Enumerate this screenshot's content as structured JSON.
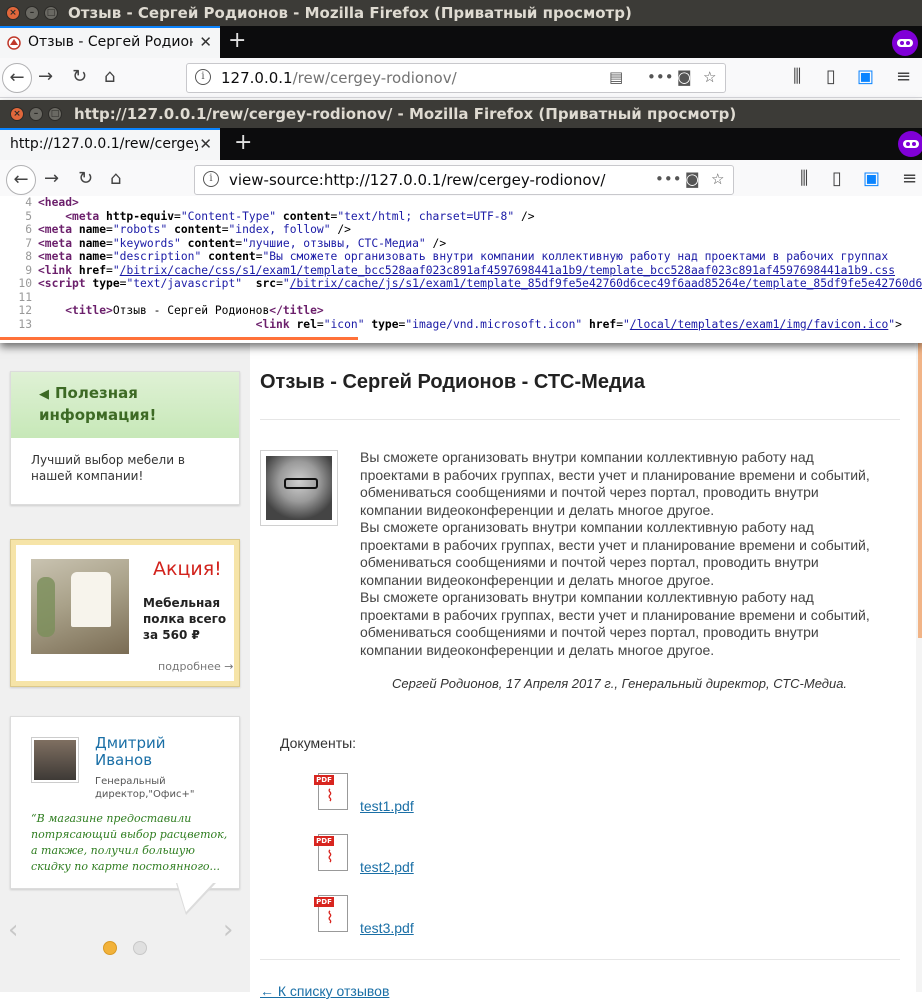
{
  "window": {
    "title": "Отзыв - Сергей Родионов - Mozilla Firefox (Приватный просмотр)",
    "tab_label": "Отзыв - Сергей Родионов",
    "url_host": "127.0.0.1",
    "url_path": "/rew/cergey-rodionov/"
  },
  "popup": {
    "title": "http://127.0.0.1/rew/cergey-rodionov/ - Mozilla Firefox (Приватный просмотр)",
    "tab_label": "http://127.0.0.1/rew/cergey",
    "url": "view-source:http://127.0.0.1/rew/cergey-rodionov/"
  },
  "source_lines": [
    {
      "n": "4",
      "parts": [
        [
          "tag",
          "<head>"
        ]
      ]
    },
    {
      "n": "5",
      "parts": [
        [
          "",
          "    "
        ],
        [
          "tag",
          "<meta "
        ],
        [
          "an",
          "http-equiv"
        ],
        [
          "",
          "="
        ],
        [
          "av",
          "\"Content-Type\""
        ],
        [
          "",
          " "
        ],
        [
          "an",
          "content"
        ],
        [
          "",
          "="
        ],
        [
          "av",
          "\"text/html; charset=UTF-8\""
        ],
        [
          "",
          " />"
        ]
      ]
    },
    {
      "n": "6",
      "parts": [
        [
          "tag",
          "<meta "
        ],
        [
          "an",
          "name"
        ],
        [
          "",
          "="
        ],
        [
          "av",
          "\"robots\""
        ],
        [
          "",
          " "
        ],
        [
          "an",
          "content"
        ],
        [
          "",
          "="
        ],
        [
          "av",
          "\"index, follow\""
        ],
        [
          "",
          " />"
        ]
      ]
    },
    {
      "n": "7",
      "parts": [
        [
          "tag",
          "<meta "
        ],
        [
          "an",
          "name"
        ],
        [
          "",
          "="
        ],
        [
          "av",
          "\"keywords\""
        ],
        [
          "",
          " "
        ],
        [
          "an",
          "content"
        ],
        [
          "",
          "="
        ],
        [
          "av",
          "\"лучшие, отзывы, СТС-Медиа\""
        ],
        [
          "",
          " />"
        ]
      ]
    },
    {
      "n": "8",
      "parts": [
        [
          "tag",
          "<meta "
        ],
        [
          "an",
          "name"
        ],
        [
          "",
          "="
        ],
        [
          "av",
          "\"description\""
        ],
        [
          "",
          " "
        ],
        [
          "an",
          "content"
        ],
        [
          "",
          "="
        ],
        [
          "av",
          "\"Вы сможете организовать внутри компании коллективную работу над проектами в рабочих группах"
        ]
      ]
    },
    {
      "n": "9",
      "parts": [
        [
          "tag",
          "<link "
        ],
        [
          "an",
          "href"
        ],
        [
          "",
          "="
        ],
        [
          "av",
          "\""
        ],
        [
          "lk",
          "/bitrix/cache/css/s1/exam1/template_bcc528aaf023c891af4597698441a1b9/template_bcc528aaf023c891af4597698441a1b9.css"
        ]
      ]
    },
    {
      "n": "10",
      "parts": [
        [
          "tag",
          "<script "
        ],
        [
          "an",
          "type"
        ],
        [
          "",
          "="
        ],
        [
          "av",
          "\"text/javascript\""
        ],
        [
          "",
          "  "
        ],
        [
          "an",
          "src"
        ],
        [
          "",
          "="
        ],
        [
          "av",
          "\""
        ],
        [
          "lk",
          "/bitrix/cache/js/s1/exam1/template_85df9fe5e42760d6cec49f6aad85264e/template_85df9fe5e42760d6cec49f6aad85264e.js"
        ]
      ]
    },
    {
      "n": "11",
      "parts": [
        [
          "",
          ""
        ]
      ]
    },
    {
      "n": "12",
      "parts": [
        [
          "",
          "    "
        ],
        [
          "tag",
          "<title>"
        ],
        [
          "",
          "Отзыв - Сергей Родионов"
        ],
        [
          "tag",
          "</title>"
        ]
      ]
    },
    {
      "n": "13",
      "parts": [
        [
          "",
          "                                "
        ],
        [
          "tag",
          "<link "
        ],
        [
          "an",
          "rel"
        ],
        [
          "",
          "="
        ],
        [
          "av",
          "\"icon\""
        ],
        [
          "",
          " "
        ],
        [
          "an",
          "type"
        ],
        [
          "",
          "="
        ],
        [
          "av",
          "\"image/vnd.microsoft.icon\""
        ],
        [
          "",
          " "
        ],
        [
          "an",
          "href"
        ],
        [
          "",
          "="
        ],
        [
          "av",
          "\""
        ],
        [
          "lk",
          "/local/templates/exam1/img/favicon.ico"
        ],
        [
          "av",
          "\""
        ],
        [
          "",
          ">"
        ]
      ]
    }
  ],
  "sidebar": {
    "useful_title": "Полезная информация!",
    "useful_text": "Лучший выбор мебели в нашей компании!",
    "promo_title": "Акция!",
    "promo_text": "Мебельная полка всего за 560 ₽",
    "promo_more": "подробнее →",
    "review_name": "Дмитрий Иванов",
    "review_role": "Генеральный директор,\"Офис+\"",
    "review_quote": "“В магазине предоставили потрясающий выбор расцветок, а также, получил большую скидку по карте постоянного..."
  },
  "main": {
    "title": "Отзыв - Сергей Родионов - СТС-Медиа",
    "paragraph": "Вы сможете организовать внутри компании коллективную работу над проектами в рабочих группах, вести учет и планирование времени и событий, обмениваться сообщениями и почтой через портал, проводить внутри компании видеоконференции и делать многое другое.",
    "signature": "Сергей Родионов, 17 Апреля 2017 г., Генеральный директор, СТС-Медиа.",
    "documents_label": "Документы:",
    "documents": [
      "test1.pdf",
      "test2.pdf",
      "test3.pdf"
    ],
    "pdf_badge": "PDF",
    "back_link": "← К списку отзывов"
  },
  "colors": {
    "accent_tab": "#0a84ff",
    "private_mask": "#8000d7",
    "progress": "#ff7139",
    "link": "#1a6fa6",
    "promo_red": "#d2231d"
  }
}
